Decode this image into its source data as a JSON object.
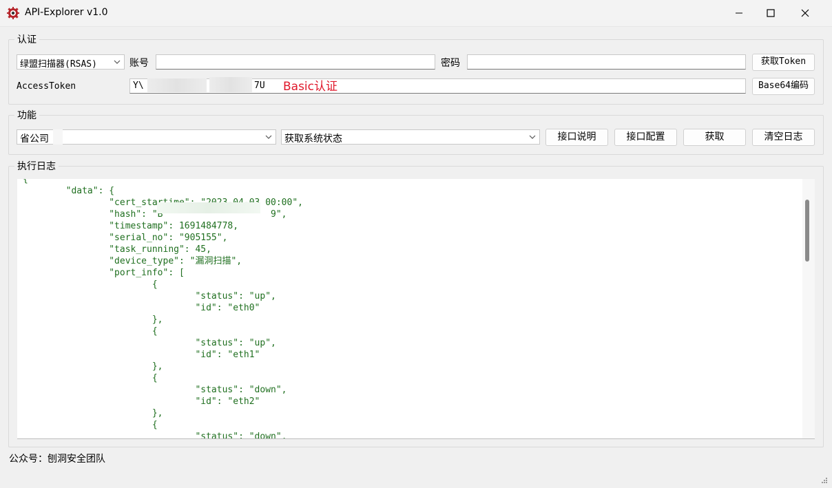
{
  "window": {
    "title": "API-Explorer v1.0"
  },
  "auth": {
    "group_label": "认证",
    "product_select": "绿盟扫描器(RSAS)",
    "account_label": "账号",
    "account_value": "",
    "password_label": "密码",
    "password_value": "",
    "get_token_label": "获取Token",
    "access_token_label": "AccessToken",
    "access_token_prefix": "Y\\",
    "access_token_suffix": "7U",
    "annotation": "Basic认证",
    "base64_label": "Base64编码"
  },
  "function": {
    "group_label": "功能",
    "org_select": "省公司",
    "api_select": "获取系统状态",
    "doc_button": "接口说明",
    "config_button": "接口配置",
    "fetch_button": "获取",
    "clear_button": "清空日志"
  },
  "log": {
    "group_label": "执行日志",
    "lines": [
      "{",
      "        \"data\": {",
      "                \"cert_startime\": \"2023-04-03 00:00\",",
      "                \"hash\": \"B                    9\",",
      "                \"timestamp\": 1691484778,",
      "                \"serial_no\": \"905155\",",
      "                \"task_running\": 45,",
      "                \"device_type\": \"漏洞扫描\",",
      "                \"port_info\": [",
      "                        {",
      "                                \"status\": \"up\",",
      "                                \"id\": \"eth0\"",
      "                        },",
      "                        {",
      "                                \"status\": \"up\",",
      "                                \"id\": \"eth1\"",
      "                        },",
      "                        {",
      "                                \"status\": \"down\",",
      "                                \"id\": \"eth2\"",
      "                        },",
      "                        {",
      "                                \"status\": \"down\","
    ]
  },
  "status": {
    "text": "公众号：刨洞安全团队"
  },
  "icons": {
    "app": "gear-icon",
    "minimize": "minimize-icon",
    "maximize": "maximize-icon",
    "close": "close-icon",
    "dropdown": "chevron-down-icon",
    "grip": "resize-grip-icon"
  },
  "colors": {
    "log_text": "#1f6f1f",
    "annotation": "#e0182b",
    "app_icon": "#b5242a"
  }
}
